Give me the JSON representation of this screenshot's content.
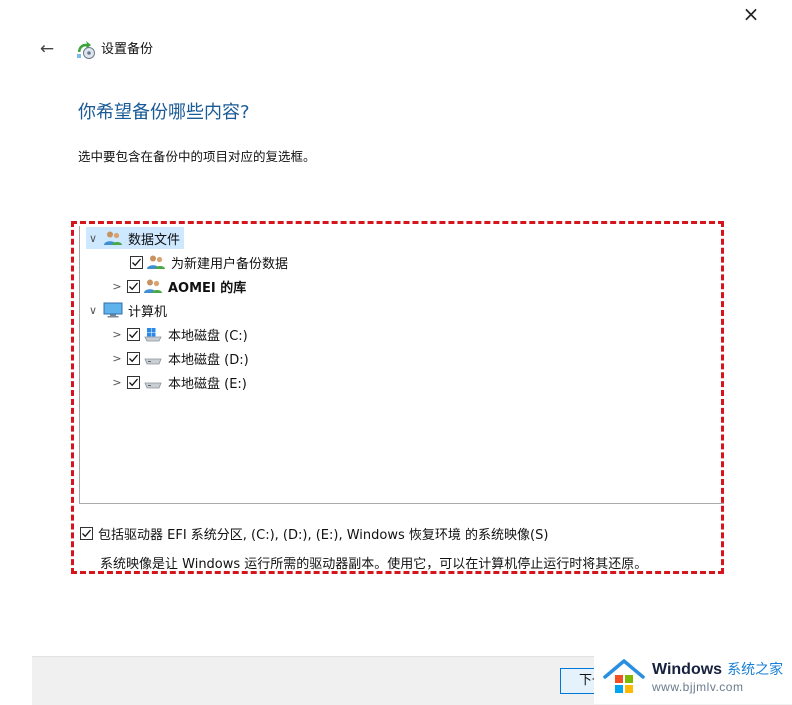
{
  "window": {
    "close_glyph": "×",
    "back_glyph": "←"
  },
  "wizard": {
    "title": "设置备份",
    "icon": "backup-wizard-icon"
  },
  "page": {
    "heading": "你希望备份哪些内容?",
    "instruction": "选中要包含在备份中的项目对应的复选框。"
  },
  "tree": {
    "data_files": {
      "label": "数据文件",
      "icon": "users-icon"
    },
    "new_users": {
      "label": "为新建用户备份数据",
      "checked": true,
      "icon": "users-icon"
    },
    "aomei": {
      "label": "AOMEI 的库",
      "checked": true,
      "icon": "users-icon"
    },
    "computer": {
      "label": "计算机",
      "icon": "monitor-icon"
    },
    "drive_c": {
      "label": "本地磁盘 (C:)",
      "checked": true,
      "icon": "windows-drive-icon"
    },
    "drive_d": {
      "label": "本地磁盘 (D:)",
      "checked": true,
      "icon": "drive-icon"
    },
    "drive_e": {
      "label": "本地磁盘 (E:)",
      "checked": true,
      "icon": "drive-icon"
    }
  },
  "system_image": {
    "label": "包括驱动器 EFI 系统分区, (C:), (D:), (E:), Windows 恢复环境 的系统映像(S)",
    "checked": true,
    "description": "系统映像是让 Windows 运行所需的驱动器副本。使用它，可以在计算机停止运行时将其还原。"
  },
  "footer": {
    "next_label": "下一步(N)"
  },
  "watermark": {
    "brand": "Windows",
    "cn": "系统之家",
    "url": "www.bjjmlv.com"
  },
  "colors": {
    "heading": "#1a5a96",
    "highlight": "#d6141e",
    "selected": "#cde8ff"
  }
}
